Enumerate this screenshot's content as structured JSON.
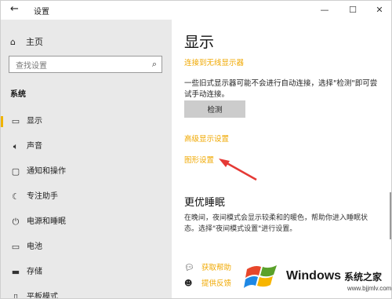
{
  "window": {
    "title": "设置",
    "back_icon": "arrow-left-icon",
    "controls": {
      "minimize": "—",
      "maximize": "☐",
      "close": "✕"
    }
  },
  "sidebar": {
    "home_label": "主页",
    "search_placeholder": "查找设置",
    "section_title": "系统",
    "items": [
      {
        "label": "显示",
        "icon": "monitor-icon",
        "active": true
      },
      {
        "label": "声音",
        "icon": "speaker-icon",
        "active": false
      },
      {
        "label": "通知和操作",
        "icon": "notification-icon",
        "active": false
      },
      {
        "label": "专注助手",
        "icon": "moon-icon",
        "active": false
      },
      {
        "label": "电源和睡眠",
        "icon": "power-icon",
        "active": false
      },
      {
        "label": "电池",
        "icon": "battery-icon",
        "active": false
      },
      {
        "label": "存储",
        "icon": "storage-icon",
        "active": false
      },
      {
        "label": "平板模式",
        "icon": "tablet-icon",
        "active": false
      }
    ]
  },
  "main": {
    "title": "显示",
    "wireless_link": "连接到无线显示器",
    "detect_text": "一些旧式显示器可能不会进行自动连接，选择\"检测\"即可尝试手动连接。",
    "detect_button": "检测",
    "advanced_link": "高级显示设置",
    "graphics_link": "图形设置",
    "sleep_title": "更优睡眠",
    "sleep_text": "在晚间，夜间模式会显示较柔和的暖色，帮助你进入睡眠状态。选择\"夜间模式设置\"进行设置。",
    "help_link": "获取帮助",
    "feedback_link": "提供反馈"
  },
  "watermark": {
    "windows_text": "Windows",
    "cn_text": "系统之家",
    "url": "www.bjjmlv.com"
  },
  "colors": {
    "accent": "#f0a800",
    "sidebar_bg": "#e9e9e9",
    "button_bg": "#cccccc",
    "arrow": "#e53935"
  }
}
